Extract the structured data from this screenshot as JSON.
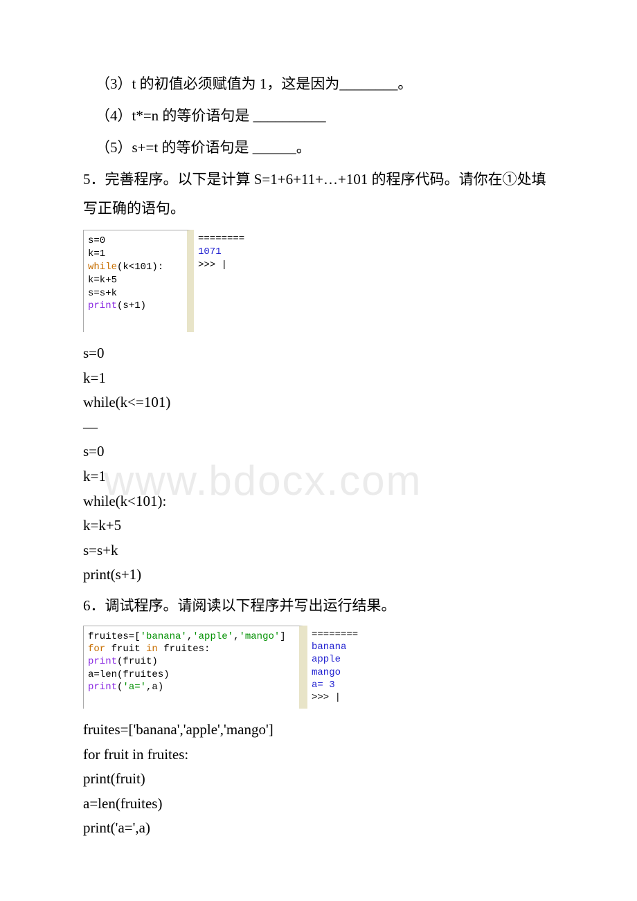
{
  "watermark": "www.bdocx.com",
  "lines": {
    "q3": "（3）t 的初值必须赋值为 1，这是因为________。",
    "q4": "（4）t*=n 的等价语句是 __________",
    "q5": "（5）s+=t 的等价语句是 ______。",
    "p5": "5．完善程序。以下是计算 S=1+6+11+…+101 的程序代码。请你在①处填写正确的语句。",
    "p6": "6．调试程序。请阅读以下程序并写出运行结果。"
  },
  "ide1": {
    "code": [
      "s=0",
      "k=1",
      "while(k<101):",
      "      k=k+5",
      "      s=s+k",
      "print(s+1)"
    ],
    "out_sep": "========",
    "out_val": "1071",
    "out_prompt": ">>> |"
  },
  "plain1": {
    "l1": "s=0",
    "l2": "k=1",
    "l3": "while(k<=101)",
    "dash": "—",
    "l4": "s=0",
    "l5": "k=1",
    "l6": "while(k<101):",
    "l7": " k=k+5",
    "l8": " s=s+k",
    "l9": "print(s+1)"
  },
  "ide2": {
    "code_l1_a": "fruites=[",
    "code_l1_s1": "'banana'",
    "code_l1_c1": ",",
    "code_l1_s2": "'apple'",
    "code_l1_c2": ",",
    "code_l1_s3": "'mango'",
    "code_l1_b": "]",
    "code_l2_a": "for",
    "code_l2_b": " fruit ",
    "code_l2_c": "in",
    "code_l2_d": " fruites:",
    "code_l3_a": "  ",
    "code_l3_b": "print",
    "code_l3_c": "(fruit)",
    "code_l4": "a=len(fruites)",
    "code_l5_a": "print",
    "code_l5_b": "(",
    "code_l5_c": "'a='",
    "code_l5_d": ",a)",
    "out_sep": "========",
    "out_l1": "banana",
    "out_l2": "apple",
    "out_l3": "mango",
    "out_l4": "a= 3",
    "out_prompt": ">>> |"
  },
  "plain2": {
    "l1": "fruites=['banana','apple','mango']",
    "l2": "for fruit in fruites:",
    "l3": " print(fruit)",
    "l4": "a=len(fruites)",
    "l5": "print('a=',a)"
  }
}
